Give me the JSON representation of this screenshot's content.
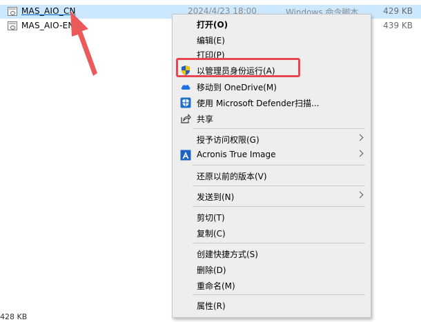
{
  "files": [
    {
      "name": "MAS_AIO_CN",
      "date": "2024/4/23 18:00",
      "type": "Windows 命令脚本",
      "size": "429 KB",
      "selected": true
    },
    {
      "name": "MAS_AIO-EN",
      "date": "",
      "type": "",
      "size": "439 KB",
      "selected": false
    }
  ],
  "status": {
    "size": "428 KB"
  },
  "menu": {
    "open": "打开(O)",
    "edit": "编辑(E)",
    "print": "打印(P)",
    "run_as_admin": "以管理员身份运行(A)",
    "move_onedrive": "移动到 OneDrive(M)",
    "defender_scan": "使用 Microsoft Defender扫描...",
    "share": "共享",
    "grant_access": "授予访问权限(G)",
    "acronis": "Acronis True Image",
    "restore_prev": "还原以前的版本(V)",
    "send_to": "发送到(N)",
    "cut": "剪切(T)",
    "copy": "复制(C)",
    "create_shortcut": "创建快捷方式(S)",
    "delete": "删除(D)",
    "rename": "重命名(M)",
    "properties": "属性(R)"
  },
  "colors": {
    "selection": "#cce8ff",
    "highlight_box": "#e8474f",
    "arrow": "#ea5a5a",
    "menu_bg": "#eeeeee"
  },
  "icons": {
    "shield": "uac-shield-icon",
    "onedrive": "onedrive-cloud-icon",
    "defender": "defender-shield-icon",
    "share": "share-icon",
    "acronis": "acronis-icon"
  }
}
